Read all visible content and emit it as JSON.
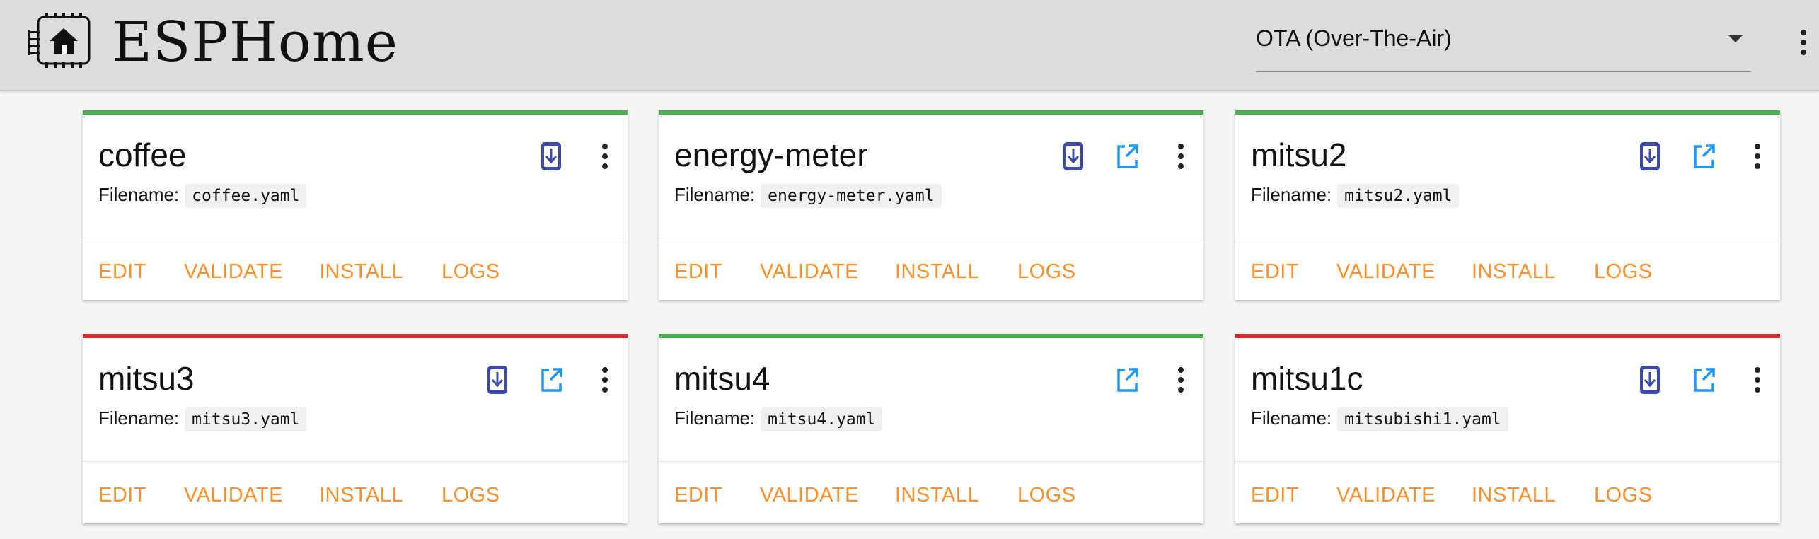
{
  "app": {
    "title": "ESPHome"
  },
  "header": {
    "mode_select": {
      "value": "OTA (Over-The-Air)"
    }
  },
  "colors": {
    "status_online": "#4caf50",
    "status_offline": "#d32f2f",
    "action_text": "#ff8f2a",
    "download_icon": "#3d49a8",
    "open_icon": "#2196f3"
  },
  "devices": [
    {
      "name": "coffee",
      "filename_label": "Filename:",
      "filename": "coffee.yaml",
      "status": "online",
      "icons": [
        "download-icon"
      ]
    },
    {
      "name": "energy-meter",
      "filename_label": "Filename:",
      "filename": "energy-meter.yaml",
      "status": "online",
      "icons": [
        "download-icon",
        "open-in-new-icon"
      ]
    },
    {
      "name": "mitsu2",
      "filename_label": "Filename:",
      "filename": "mitsu2.yaml",
      "status": "online",
      "icons": [
        "download-icon",
        "open-in-new-icon"
      ]
    },
    {
      "name": "mitsu3",
      "filename_label": "Filename:",
      "filename": "mitsu3.yaml",
      "status": "offline",
      "icons": [
        "download-icon",
        "open-in-new-icon"
      ]
    },
    {
      "name": "mitsu4",
      "filename_label": "Filename:",
      "filename": "mitsu4.yaml",
      "status": "online",
      "icons": [
        "open-in-new-icon"
      ]
    },
    {
      "name": "mitsu1c",
      "filename_label": "Filename:",
      "filename": "mitsubishi1.yaml",
      "status": "offline",
      "icons": [
        "download-icon",
        "open-in-new-icon"
      ]
    }
  ],
  "card_actions": {
    "edit": "EDIT",
    "validate": "VALIDATE",
    "install": "INSTALL",
    "logs": "LOGS"
  }
}
